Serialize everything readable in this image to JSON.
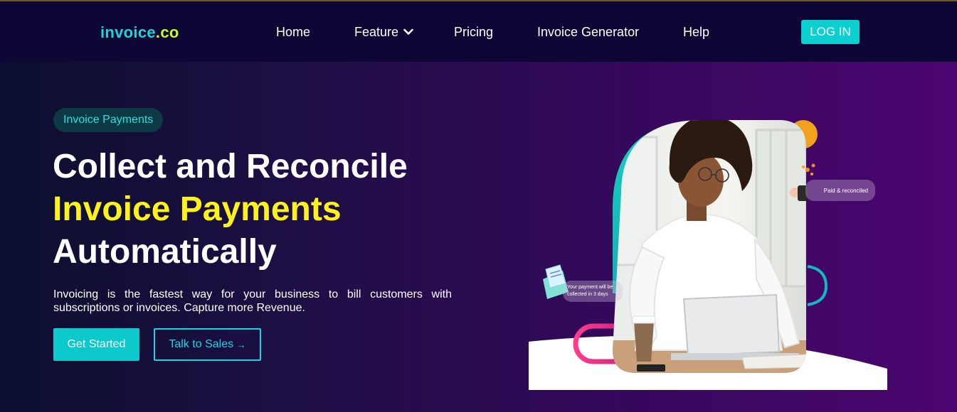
{
  "brand": {
    "part1": "invoice",
    "part2": ".co"
  },
  "nav": {
    "items": [
      {
        "label": "Home"
      },
      {
        "label": "Feature"
      },
      {
        "label": "Pricing"
      },
      {
        "label": "Invoice Generator"
      },
      {
        "label": "Help"
      }
    ],
    "login_label": "LOG IN"
  },
  "hero": {
    "badge": "Invoice Payments",
    "headline_line1": "Collect and Reconcile",
    "headline_line2": "Invoice Payments",
    "headline_line3": "Automatically",
    "description": "Invoicing is the fastest way for your business to bill customers with subscriptions or invoices. Capture more Revenue.",
    "cta_primary": "Get Started",
    "cta_secondary": "Talk to Sales",
    "cta_secondary_arrow": "→"
  },
  "illustration": {
    "toast_paid": "Paid & reconciled",
    "toast_payment_line1": "Your payment will be",
    "toast_payment_line2": "collected in 3 days"
  },
  "colors": {
    "brand_teal": "#16d6d6",
    "brand_lime": "#c7ff1c",
    "accent_teal": "#0cc9cb",
    "headline_yellow": "#fff21a",
    "hero_gradient_start": "#0b0f2e",
    "hero_gradient_end": "#4b0570"
  }
}
